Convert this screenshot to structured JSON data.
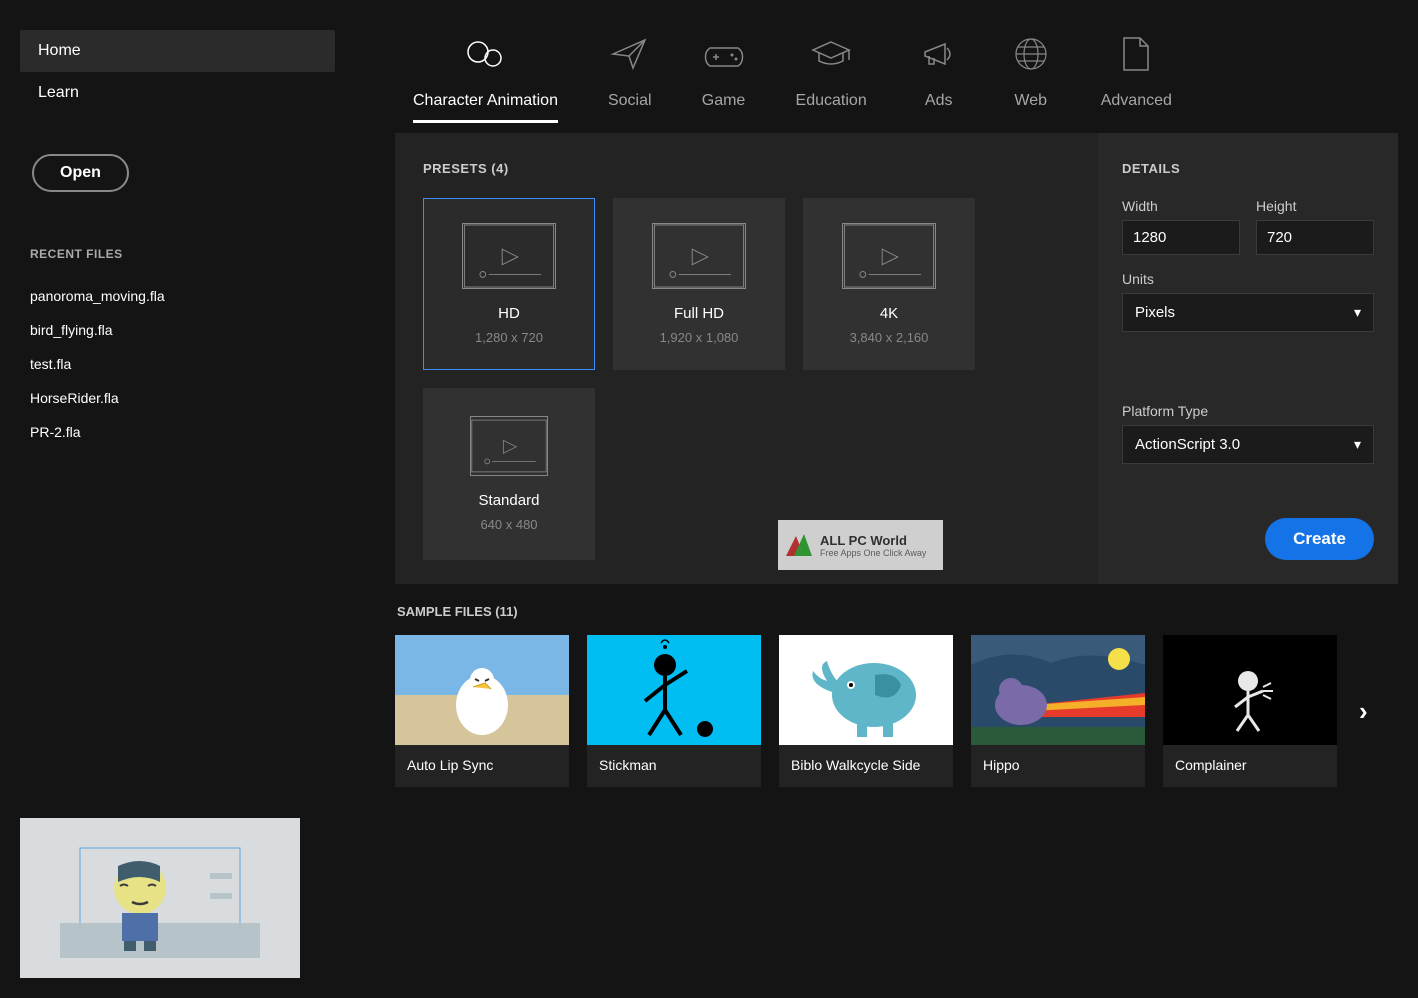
{
  "sidebar": {
    "nav": [
      {
        "label": "Home",
        "active": true
      },
      {
        "label": "Learn",
        "active": false
      }
    ],
    "open_label": "Open",
    "recent_label": "RECENT FILES",
    "recent": [
      "panoroma_moving.fla",
      "bird_flying.fla",
      "test.fla",
      "HorseRider.fla",
      "PR-2.fla"
    ]
  },
  "tabs": [
    {
      "label": "Character Animation",
      "active": true
    },
    {
      "label": "Social",
      "active": false
    },
    {
      "label": "Game",
      "active": false
    },
    {
      "label": "Education",
      "active": false
    },
    {
      "label": "Ads",
      "active": false
    },
    {
      "label": "Web",
      "active": false
    },
    {
      "label": "Advanced",
      "active": false
    }
  ],
  "presets": {
    "title": "PRESETS (4)",
    "items": [
      {
        "name": "HD",
        "dim": "1,280 x 720",
        "selected": true
      },
      {
        "name": "Full HD",
        "dim": "1,920 x 1,080",
        "selected": false
      },
      {
        "name": "4K",
        "dim": "3,840 x 2,160",
        "selected": false
      },
      {
        "name": "Standard",
        "dim": "640 x 480",
        "selected": false
      }
    ]
  },
  "details": {
    "title": "DETAILS",
    "width_label": "Width",
    "width_value": "1280",
    "height_label": "Height",
    "height_value": "720",
    "units_label": "Units",
    "units_value": "Pixels",
    "platform_label": "Platform Type",
    "platform_value": "ActionScript 3.0",
    "create_label": "Create"
  },
  "samples": {
    "title": "SAMPLE FILES (11)",
    "items": [
      "Auto Lip Sync",
      "Stickman",
      "Biblo Walkcycle Side",
      "Hippo",
      "Complainer"
    ]
  },
  "watermark": {
    "title": "ALL PC World",
    "sub": "Free Apps One Click Away"
  }
}
